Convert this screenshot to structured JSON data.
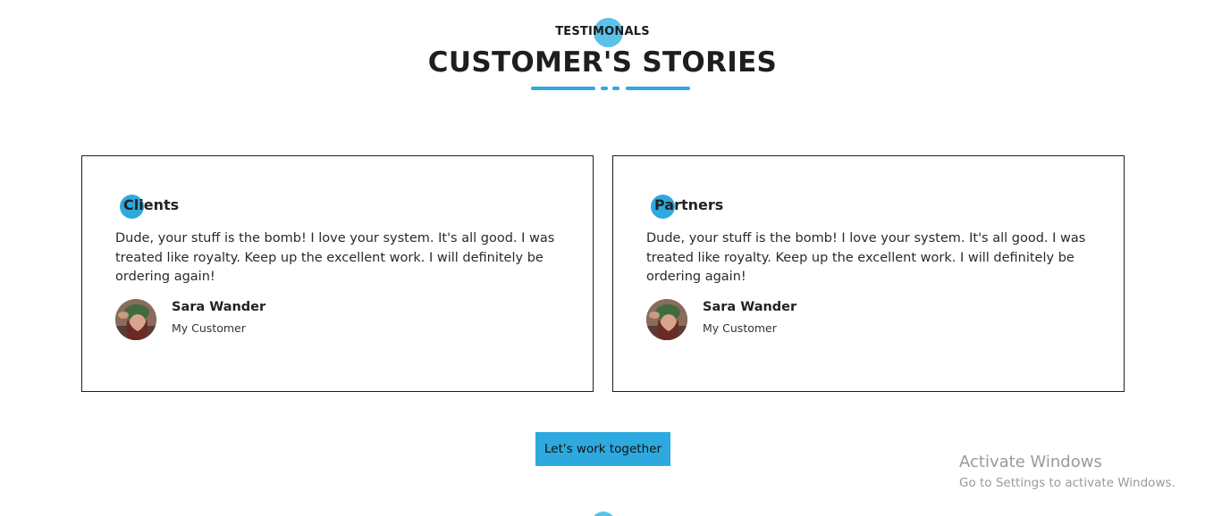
{
  "header": {
    "eyebrow": "TESTIMONALS",
    "title": "CUSTOMER'S STORIES"
  },
  "cards": [
    {
      "title": "Clients",
      "quote": "Dude, your stuff is the bomb! I love your system. It's all good. I was treated like royalty. Keep up the excellent work. I will definitely be ordering again!",
      "name": "Sara Wander",
      "role": "My Customer"
    },
    {
      "title": "Partners",
      "quote": "Dude, your stuff is the bomb! I love your system. It's all good. I was treated like royalty. Keep up the excellent work. I will definitely be ordering again!",
      "name": "Sara Wander",
      "role": "My Customer"
    }
  ],
  "cta": {
    "label": "Let's work together"
  },
  "watermark": {
    "title": "Activate Windows",
    "subtitle": "Go to Settings to activate Windows."
  },
  "colors": {
    "accent": "#2ea9df",
    "accent_light": "#5bc3ea",
    "text": "#222222",
    "border": "#1e1e1e"
  }
}
